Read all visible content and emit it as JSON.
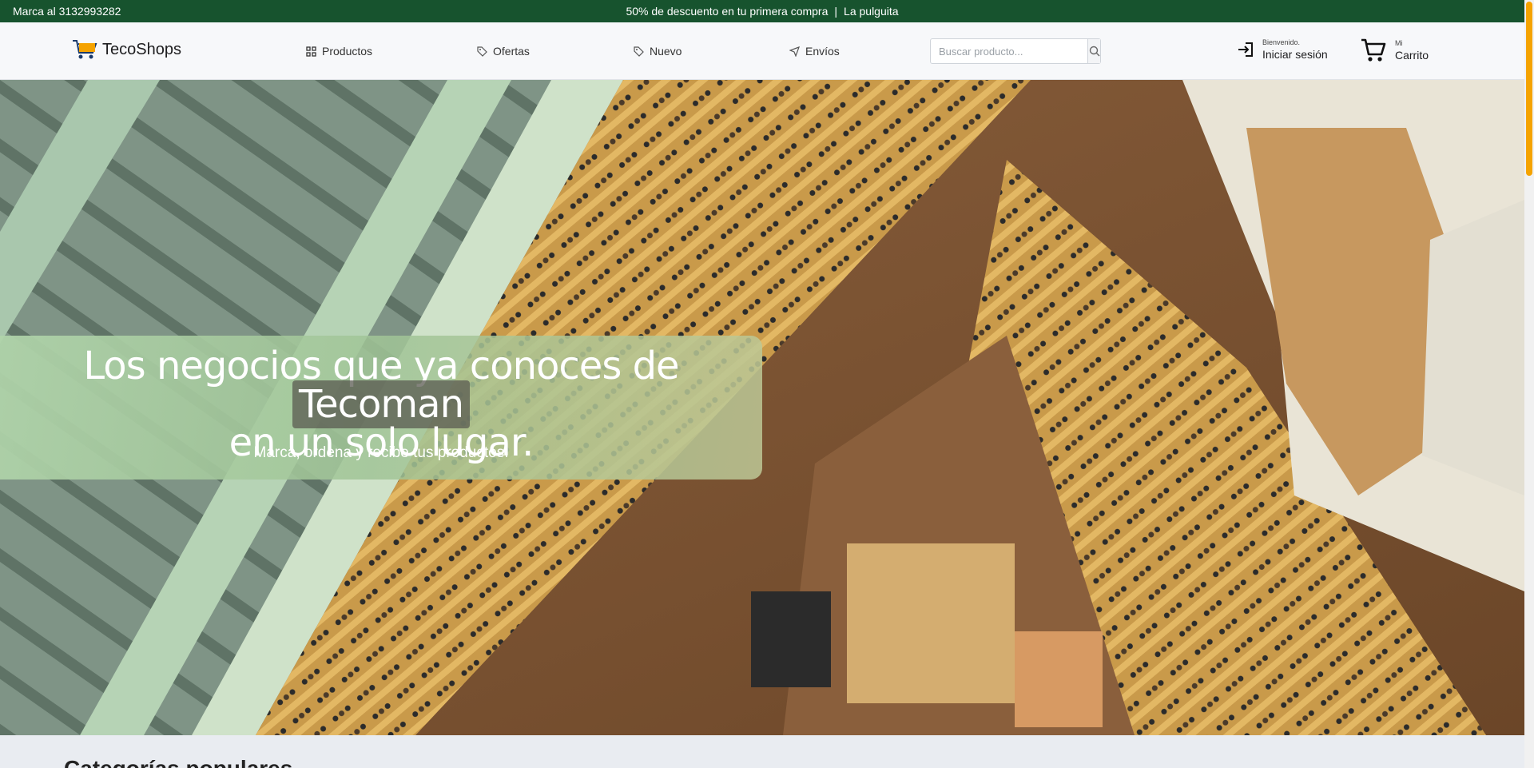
{
  "topbar": {
    "contact": "Marca al 3132993282",
    "promo": "50% de descuento en tu primera compra",
    "separator": "|",
    "store": "La pulguita"
  },
  "header": {
    "brand": "TecoShops",
    "nav": [
      {
        "label": "Productos",
        "icon": "grid-icon"
      },
      {
        "label": "Ofertas",
        "icon": "tag-icon"
      },
      {
        "label": "Nuevo",
        "icon": "tag-icon"
      },
      {
        "label": "Envíos",
        "icon": "send-icon"
      }
    ],
    "search": {
      "placeholder": "Buscar producto..."
    },
    "login": {
      "small": "Bienvenido.",
      "big": "Iniciar sesión"
    },
    "cart": {
      "small": "Mi",
      "big": "Carrito"
    }
  },
  "hero": {
    "title_part1": "Los negocios que ya conoces de",
    "title_highlight": "Tecoman",
    "title_part2": "en un solo lugar.",
    "subtitle": "Marca, ordena y recibe tus productos."
  },
  "categories": {
    "heading": "Categorías populares"
  },
  "colors": {
    "topbar": "#17532e",
    "accent": "#f5a300",
    "hero_box": "#b0d4aa"
  }
}
